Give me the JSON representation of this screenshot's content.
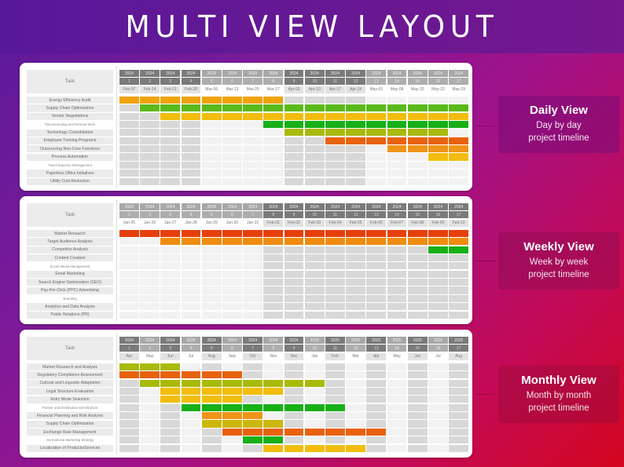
{
  "title": "MULTI VIEW LAYOUT",
  "colors": {
    "orange": "#f0a30a",
    "green": "#5cb91a",
    "yellow": "#f2bd0e",
    "dkgreen": "#17b017",
    "olive": "#a8ba0c",
    "dkorange": "#e8620e",
    "orange2": "#f09418",
    "red": "#e5400c",
    "amber": "#ef8c10"
  },
  "views": [
    {
      "label_title": "Daily View",
      "label_line1": "Day by day",
      "label_line2": "project timeline",
      "task_header": "Task",
      "years": [
        "2024",
        "2024",
        "2024",
        "2024",
        "2024",
        "2024",
        "2024",
        "2024",
        "2024",
        "2024",
        "2024",
        "2024",
        "2024",
        "2024",
        "2024",
        "2024",
        "2024"
      ],
      "numbers": [
        "1",
        "2",
        "3",
        "4",
        "5",
        "6",
        "7",
        "8",
        "9",
        "10",
        "11",
        "12",
        "13",
        "14",
        "15",
        "16",
        "17"
      ],
      "dates": [
        "Feb-07",
        "Feb-14",
        "Feb-21",
        "Feb-28",
        "Mar-06",
        "Mar-13",
        "Mar-20",
        "Mar-27",
        "Apr-03",
        "Apr-10",
        "Apr-17",
        "Apr-24",
        "May-01",
        "May-08",
        "May-15",
        "May-22",
        "May-29"
      ],
      "shade": [
        "g",
        "g",
        "g",
        "g",
        "l",
        "l",
        "l",
        "l",
        "g",
        "g",
        "g",
        "g",
        "l",
        "l",
        "l",
        "l",
        "l"
      ],
      "tasks": [
        {
          "name": "Energy Efficiency Audit",
          "color": "orange",
          "start": 1,
          "end": 8
        },
        {
          "name": "Supply Chain Optimization",
          "color": "green",
          "start": 2,
          "end": 17
        },
        {
          "name": "Vendor Negotiations",
          "color": "yellow",
          "start": 3,
          "end": 17
        },
        {
          "name": "Telecommuting and Remote Work",
          "color": "dkgreen",
          "start": 8,
          "end": 17,
          "alt": true
        },
        {
          "name": "Technology Consolidation",
          "color": "olive",
          "start": 9,
          "end": 16
        },
        {
          "name": "Employee Training Programs",
          "color": "dkorange",
          "start": 11,
          "end": 17
        },
        {
          "name": "Outsourcing Non-Core Functions",
          "color": "orange2",
          "start": 14,
          "end": 17
        },
        {
          "name": "Process Automation",
          "color": "yellow",
          "start": 16,
          "end": 17
        },
        {
          "name": "Travel Expense Management",
          "alt": true
        },
        {
          "name": "Paperless Office Initiatives"
        },
        {
          "name": "Utility Cost Reduction"
        }
      ]
    },
    {
      "label_title": "Weekly View",
      "label_line1": "Week by week",
      "label_line2": "project timeline",
      "task_header": "Task",
      "years": [
        "2024",
        "2024",
        "2024",
        "2024",
        "2024",
        "2024",
        "2024",
        "2024",
        "2024",
        "2024",
        "2024",
        "2024",
        "2024",
        "2024",
        "2024",
        "2024",
        "2024"
      ],
      "numbers": [
        "1",
        "2",
        "3",
        "4",
        "5",
        "6",
        "7",
        "8",
        "9",
        "10",
        "11",
        "12",
        "13",
        "14",
        "15",
        "16",
        "17"
      ],
      "dates": [
        "Jan-25",
        "Jan-26",
        "Jan-27",
        "Jan-28",
        "Jan-29",
        "Jan-30",
        "Jan-31",
        "Feb-01",
        "Feb-02",
        "Feb-03",
        "Feb-04",
        "Feb-05",
        "Feb-06",
        "Feb-07",
        "Feb-08",
        "Feb-09",
        "Feb-10"
      ],
      "shade": [
        "l",
        "l",
        "l",
        "l",
        "l",
        "l",
        "l",
        "g",
        "g",
        "g",
        "g",
        "g",
        "g",
        "g",
        "g",
        "g",
        "g"
      ],
      "tasks": [
        {
          "name": "Market Research",
          "color": "red",
          "start": 1,
          "end": 17
        },
        {
          "name": "Target Audience Analysis",
          "color": "amber",
          "start": 3,
          "end": 17
        },
        {
          "name": "Competitor Analysis",
          "color": "dkgreen",
          "start": 16,
          "end": 17
        },
        {
          "name": "Content Creation"
        },
        {
          "name": "Social Media Management",
          "alt": true
        },
        {
          "name": "Email Marketing"
        },
        {
          "name": "Search Engine Optimization (SEO)"
        },
        {
          "name": "Pay-Per-Click (PPC) Advertising"
        },
        {
          "name": "Branding",
          "alt": true
        },
        {
          "name": "Analytics and Data Analysis"
        },
        {
          "name": "Public Relations (PR)"
        }
      ]
    },
    {
      "label_title": "Monthly View",
      "label_line1": "Month by month",
      "label_line2": "project timeline",
      "task_header": "Task",
      "years": [
        "2024",
        "2024",
        "2024",
        "2024",
        "2024",
        "2024",
        "2024",
        "2024",
        "2024",
        "2025",
        "2025",
        "2025",
        "2025",
        "2025",
        "2025",
        "2025",
        "2025"
      ],
      "numbers": [
        "1",
        "2",
        "3",
        "4",
        "5",
        "6",
        "7",
        "8",
        "9",
        "10",
        "11",
        "12",
        "13",
        "14",
        "15",
        "16",
        "17"
      ],
      "dates": [
        "Apr",
        "May",
        "Jun",
        "Jul",
        "Aug",
        "Sep",
        "Oct",
        "Nov",
        "Dec",
        "Jan",
        "Feb",
        "Mar",
        "Apr",
        "May",
        "Jun",
        "Jul",
        "Aug"
      ],
      "shade": [
        "g",
        "l",
        "g",
        "l",
        "g",
        "l",
        "g",
        "l",
        "g",
        "l",
        "g",
        "l",
        "g",
        "l",
        "g",
        "l",
        "g"
      ],
      "tasks": [
        {
          "name": "Market Research and Analysis",
          "color": "olive",
          "start": 1,
          "end": 3
        },
        {
          "name": "Regulatory Compliance Assessment",
          "color": "dkorange",
          "start": 1,
          "end": 6
        },
        {
          "name": "Cultural and Linguistic Adaptation",
          "color": "olive",
          "start": 2,
          "end": 10
        },
        {
          "name": "Legal Structure Evaluation",
          "color": "yellow",
          "start": 3,
          "end": 8
        },
        {
          "name": "Entry Mode Selection",
          "color": "yellow",
          "start": 3,
          "end": 6
        },
        {
          "name": "Partner and Distribution Identification",
          "color": "dkgreen",
          "start": 4,
          "end": 11,
          "alt": true
        },
        {
          "name": "Financial Planning and Risk Analysis",
          "color": "orange2",
          "start": 5,
          "end": 7
        },
        {
          "name": "Supply Chain Optimization",
          "color": "olive2",
          "start": 5,
          "end": 8
        },
        {
          "name": "Exchange Rate Management",
          "color": "dkorange",
          "start": 6,
          "end": 13
        },
        {
          "name": "International Marketing Strategy",
          "color": "dkgreen",
          "start": 7,
          "end": 8,
          "alt": true
        },
        {
          "name": "Localization of Products/Services",
          "color": "yellow",
          "start": 8,
          "end": 12
        }
      ]
    }
  ]
}
